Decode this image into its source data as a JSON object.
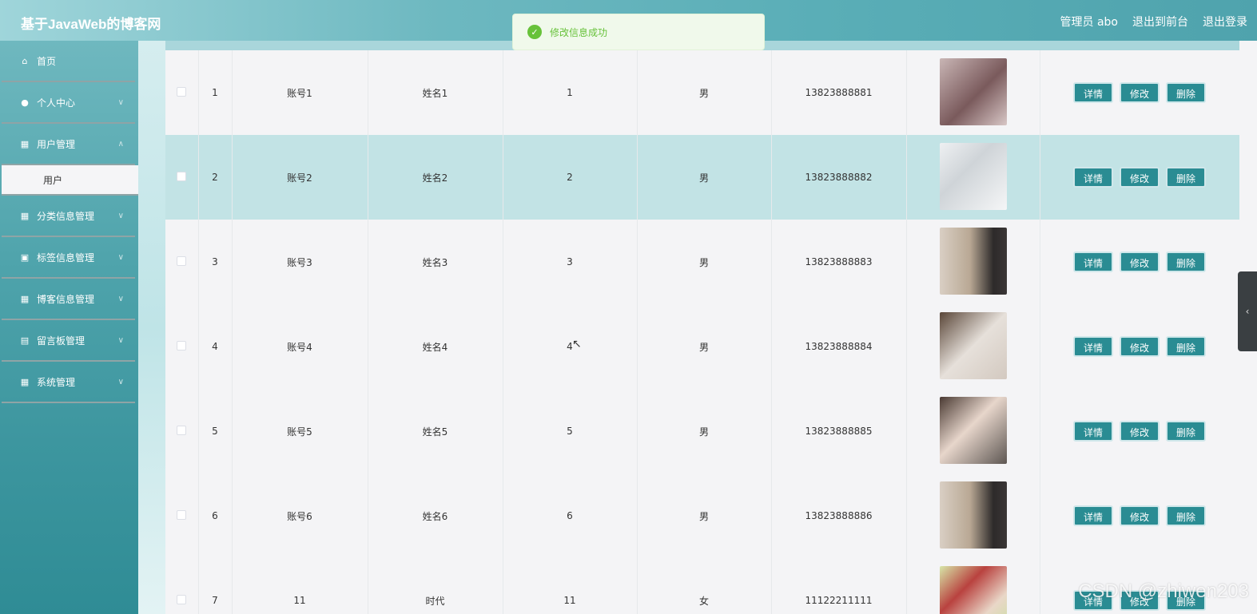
{
  "header": {
    "title": "基于JavaWeb的博客网",
    "user": "管理员 abo",
    "to_front": "退出到前台",
    "logout": "退出登录"
  },
  "toast": {
    "message": "修改信息成功"
  },
  "sidebar": {
    "items": [
      {
        "label": "首页",
        "icon": "home-icon"
      },
      {
        "label": "个人中心",
        "icon": "user-icon"
      },
      {
        "label": "用户管理",
        "icon": "grid-icon"
      },
      {
        "label": "分类信息管理",
        "icon": "grid-icon"
      },
      {
        "label": "标签信息管理",
        "icon": "briefcase-icon"
      },
      {
        "label": "博客信息管理",
        "icon": "grid-icon"
      },
      {
        "label": "留言板管理",
        "icon": "document-icon"
      },
      {
        "label": "系统管理",
        "icon": "grid-icon"
      }
    ],
    "submenu": {
      "label": "用户"
    }
  },
  "table": {
    "rows": [
      {
        "index": "1",
        "account": "账号1",
        "name": "姓名1",
        "age": "1",
        "gender": "男",
        "phone": "13823888881"
      },
      {
        "index": "2",
        "account": "账号2",
        "name": "姓名2",
        "age": "2",
        "gender": "男",
        "phone": "13823888882"
      },
      {
        "index": "3",
        "account": "账号3",
        "name": "姓名3",
        "age": "3",
        "gender": "男",
        "phone": "13823888883"
      },
      {
        "index": "4",
        "account": "账号4",
        "name": "姓名4",
        "age": "4",
        "gender": "男",
        "phone": "13823888884"
      },
      {
        "index": "5",
        "account": "账号5",
        "name": "姓名5",
        "age": "5",
        "gender": "男",
        "phone": "13823888885"
      },
      {
        "index": "6",
        "account": "账号6",
        "name": "姓名6",
        "age": "6",
        "gender": "男",
        "phone": "13823888886"
      },
      {
        "index": "7",
        "account": "11",
        "name": "时代",
        "age": "11",
        "gender": "女",
        "phone": "11122211111"
      }
    ],
    "actions": {
      "detail": "详情",
      "edit": "修改",
      "delete": "删除"
    }
  },
  "watermark": "CSDN @zhiwen203",
  "colors": {
    "accent": "#2a8c93",
    "highlight_row": "#c2e3e5",
    "success": "#67c23a"
  }
}
